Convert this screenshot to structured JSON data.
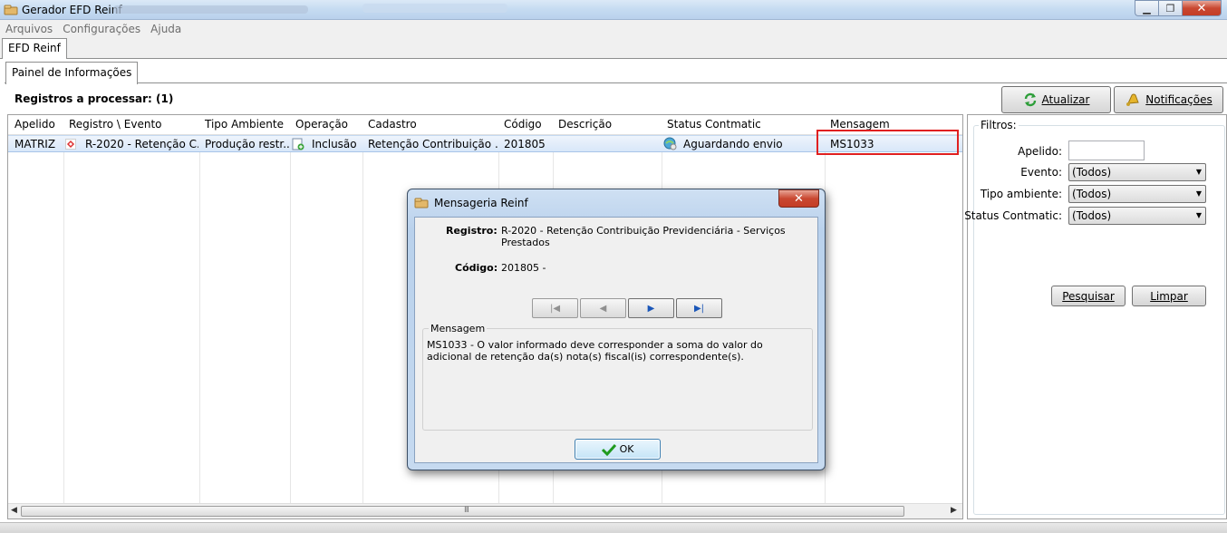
{
  "window": {
    "title": "Gerador EFD Reinf"
  },
  "menu": {
    "items": [
      "Arquivos",
      "Configurações",
      "Ajuda"
    ]
  },
  "tabs": {
    "outer": "EFD Reinf",
    "inner": "Painel de Informações"
  },
  "panel": {
    "records_label": "Registros a processar: (1)",
    "refresh_button": "Atualizar",
    "notifications_button": "Notificações"
  },
  "grid": {
    "columns": [
      "Apelido",
      "Registro \\ Evento",
      "Tipo Ambiente",
      "Operação",
      "Cadastro",
      "Código",
      "Descrição",
      "Status Contmatic",
      "Mensagem"
    ],
    "rows": [
      {
        "apelido": "MATRIZ",
        "registro": "R-2020 - Retenção C...",
        "tipo_ambiente": "Produção restr...",
        "operacao": "Inclusão",
        "cadastro": "Retenção Contribuição ...",
        "codigo": "201805",
        "descricao": "",
        "status": "Aguardando envio",
        "mensagem": "MS1033"
      }
    ],
    "scroll_grip": "III"
  },
  "filters": {
    "title": "Filtros:",
    "apelido_label": "Apelido:",
    "apelido_value": "",
    "evento_label": "Evento:",
    "evento_value": "(Todos)",
    "tipo_label": "Tipo ambiente:",
    "tipo_value": "(Todos)",
    "status_label": "Status Contmatic:",
    "status_value": "(Todos)",
    "search_button": "Pesquisar",
    "clear_button": "Limpar"
  },
  "dialog": {
    "title": "Mensageria Reinf",
    "registro_label": "Registro:",
    "registro_value": "R-2020 - Retenção Contribuição Previdenciária - Serviços Prestados",
    "codigo_label": "Código:",
    "codigo_value": "201805 -",
    "message_group": "Mensagem",
    "message_text": "MS1033 - O valor informado deve corresponder a soma do valor do adicional de retenção da(s) nota(s) fiscal(is) correspondente(s).",
    "ok_button": "OK"
  },
  "colors": {
    "highlight_border": "#e02020",
    "selected_row": "#d8e7f9",
    "nav_active": "#1a56b8"
  }
}
